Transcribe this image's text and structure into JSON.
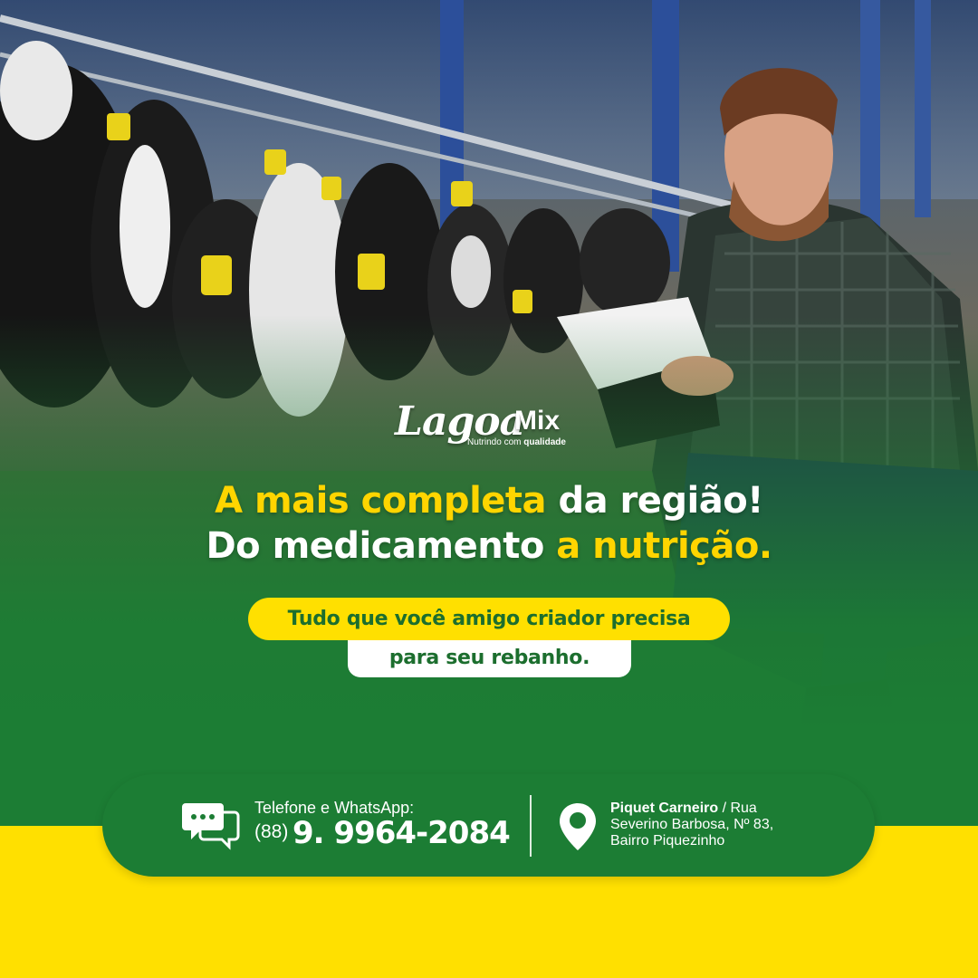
{
  "brand": {
    "name_part1": "Lagoa",
    "name_part2": "Mix",
    "tagline_prefix": "Nutrindo com",
    "tagline_bold": "qualidade"
  },
  "headline": {
    "line1_yellow": "A mais completa",
    "line1_white": " da região!",
    "line2_white": "Do medicamento ",
    "line2_yellow": "a nutrição."
  },
  "subheadline": {
    "line1": "Tudo que você amigo criador precisa",
    "line2": "para seu rebanho."
  },
  "contact": {
    "phone_label": "Telefone e WhatsApp:",
    "phone_area": "(88)",
    "phone_number": "9. 9964-2084",
    "address_city": "Piquet Carneiro",
    "address_line1_rest": " / Rua",
    "address_line2": "Severino Barbosa, Nº 83,",
    "address_line3": "Bairro Piquezinho"
  },
  "icons": {
    "chat": "chat-bubbles-icon",
    "location": "location-pin-icon"
  },
  "colors": {
    "green": "#1c7d34",
    "yellow": "#ffe000",
    "headline_yellow": "#ffd500",
    "white": "#ffffff"
  }
}
